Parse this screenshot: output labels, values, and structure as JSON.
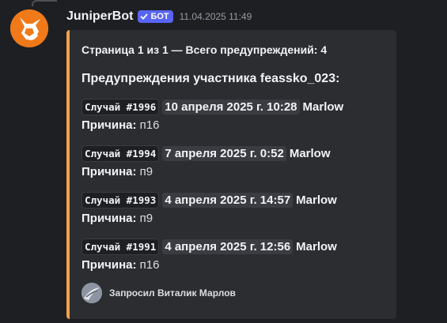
{
  "message": {
    "author": "JuniperBot",
    "bot_tag": "БОТ",
    "bot_tag_icon": "checkmark-icon",
    "timestamp": "11.04.2025 11:49",
    "avatar_icon": "fox-icon"
  },
  "embed": {
    "accent_color": "#f0a04b",
    "author": "Страница 1 из 1 — Всего предупреждений: 4",
    "title": "Предупреждения участника feassko_023:",
    "reason_label": "Причина:",
    "entries": [
      {
        "case": "Случай #1996",
        "date": "10 апреля 2025 г. 10:28",
        "moderator": "Marlow",
        "reason": "п16"
      },
      {
        "case": "Случай #1994",
        "date": "7 апреля 2025 г. 0:52",
        "moderator": "Marlow",
        "reason": "п9"
      },
      {
        "case": "Случай #1993",
        "date": "4 апреля 2025 г. 14:57",
        "moderator": "Marlow",
        "reason": "п9"
      },
      {
        "case": "Случай #1991",
        "date": "4 апреля 2025 г. 12:56",
        "moderator": "Marlow",
        "reason": "п16"
      }
    ],
    "footer": {
      "text": "Запросил Виталик Марлов",
      "icon": "requester-avatar-icon"
    }
  }
}
